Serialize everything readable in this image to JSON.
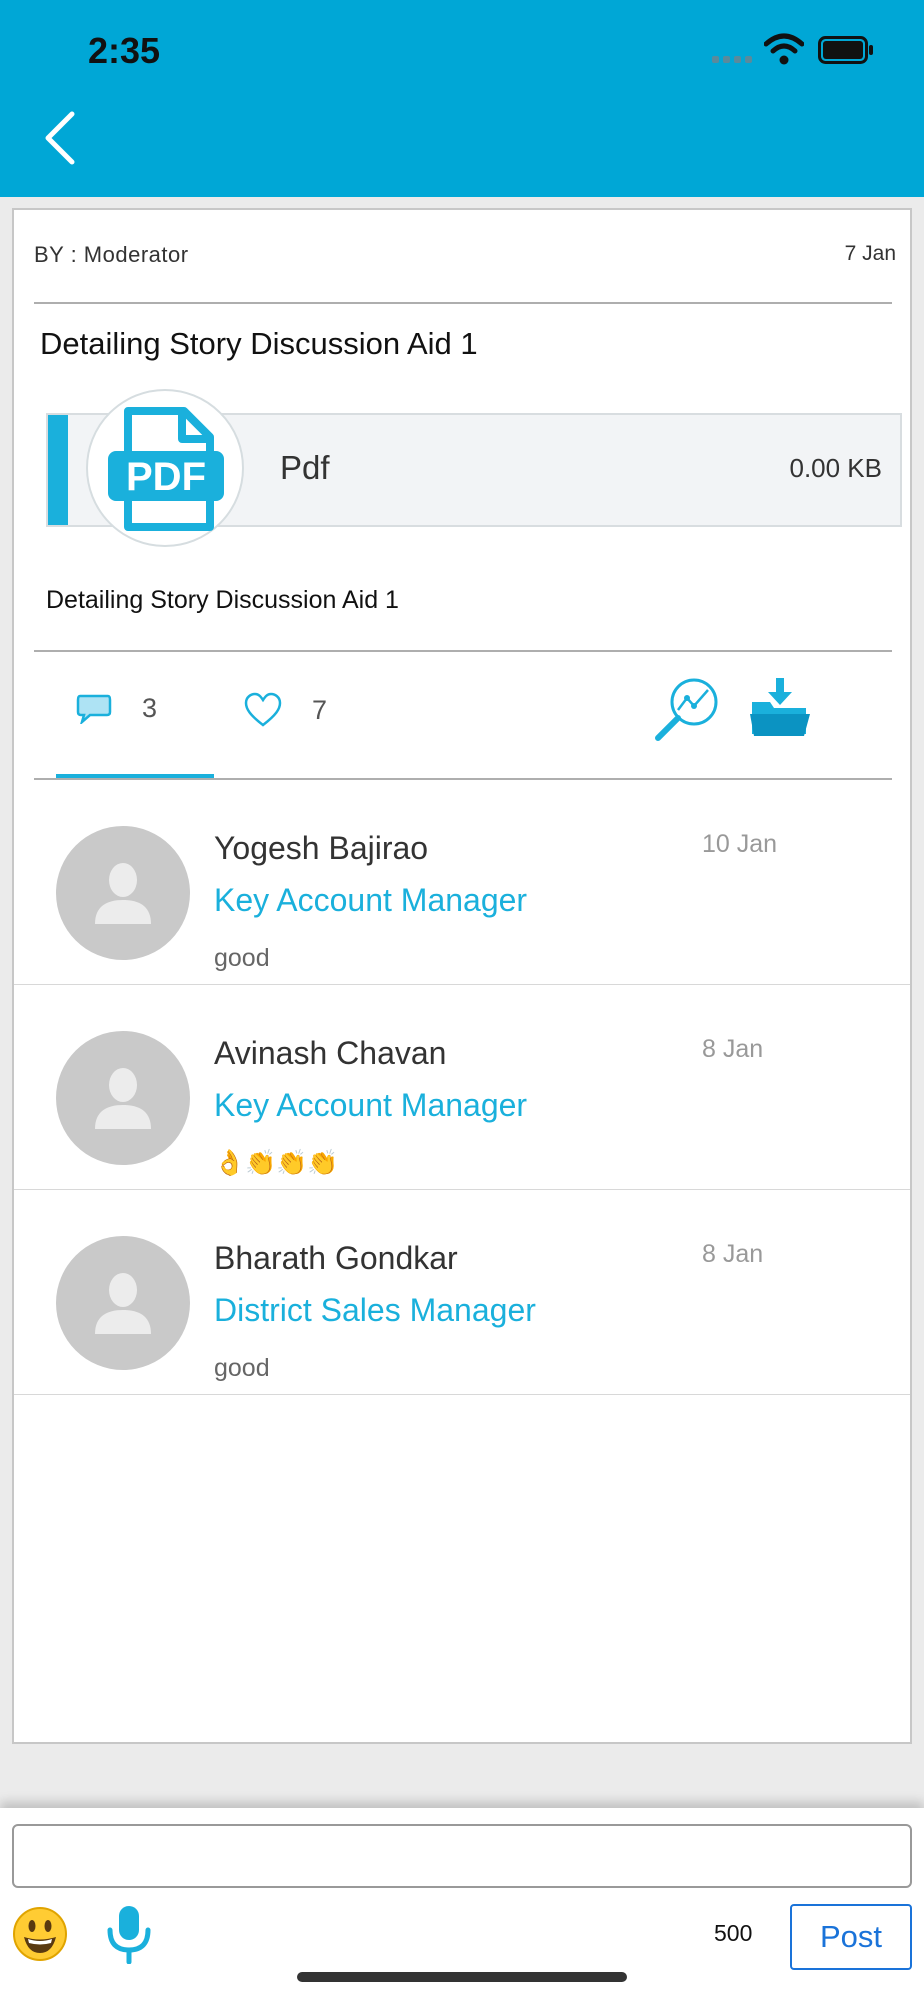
{
  "status_bar": {
    "time": "2:35"
  },
  "post": {
    "by": "BY : Moderator",
    "date": "7 Jan",
    "title": "Detailing Story Discussion Aid 1",
    "attachment": {
      "type": "Pdf",
      "size": "0.00 KB",
      "icon_text": "PDF"
    },
    "description": "Detailing Story Discussion Aid 1",
    "comment_count": "3",
    "like_count": "7"
  },
  "comments": [
    {
      "name": "Yogesh Bajirao",
      "role": "Key Account Manager",
      "text": "good",
      "date": "10 Jan"
    },
    {
      "name": "Avinash Chavan",
      "role": "Key Account Manager",
      "text": "👌👏👏👏",
      "date": "8 Jan"
    },
    {
      "name": "Bharath Gondkar",
      "role": "District Sales Manager",
      "text": "good",
      "date": "8 Jan"
    }
  ],
  "composer": {
    "placeholder": "",
    "char_count": "500",
    "post_label": "Post"
  },
  "colors": {
    "brand": "#00a7d6",
    "accent": "#1ab0dc",
    "post_button": "#1a73d9"
  }
}
